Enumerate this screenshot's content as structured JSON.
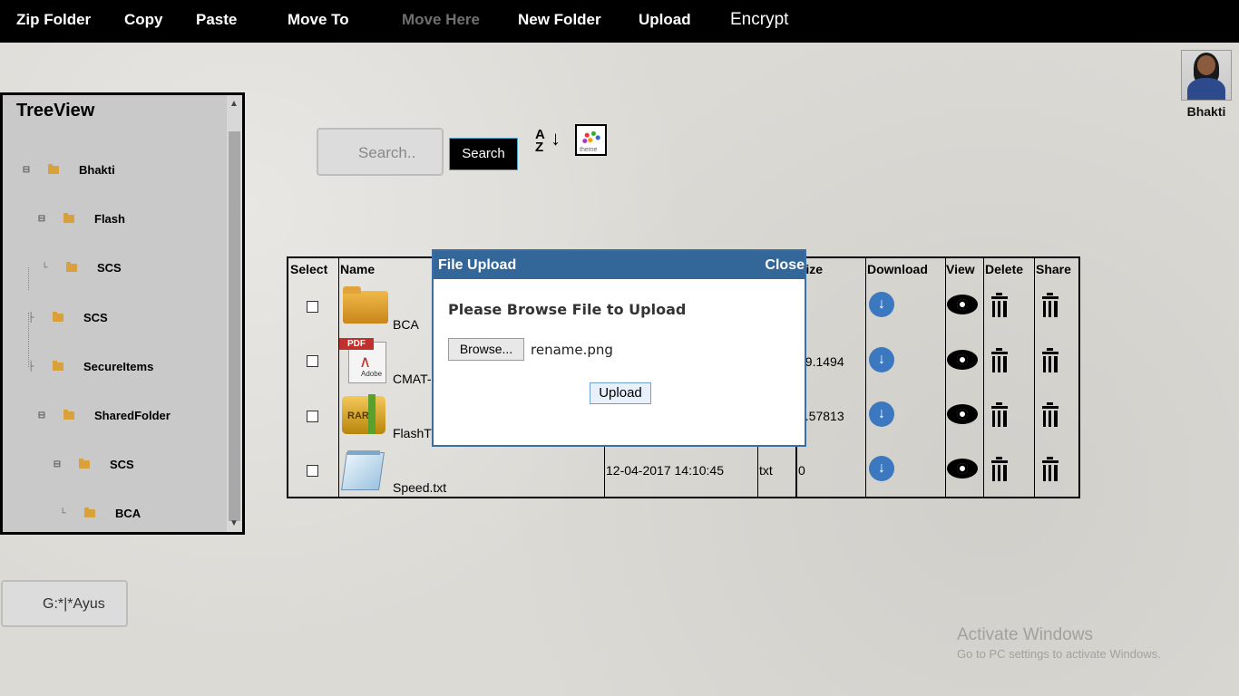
{
  "menu": {
    "zip_folder": "Zip Folder",
    "copy": "Copy",
    "paste": "Paste",
    "move_to": "Move To",
    "move_here": "Move Here",
    "new_folder": "New Folder",
    "upload": "Upload",
    "encrypt": "Encrypt"
  },
  "user": {
    "name": "Bhakti"
  },
  "tree": {
    "title": "TreeView",
    "nodes": [
      "Bhakti",
      "Flash",
      "SCS",
      "SCS",
      "SecureItems",
      "SharedFolder",
      "SCS",
      "BCA"
    ]
  },
  "search": {
    "placeholder": "Search..",
    "button": "Search"
  },
  "table": {
    "headers": {
      "select": "Select",
      "name": "Name",
      "size": "Size",
      "download": "Download",
      "view": "View",
      "delete": "Delete",
      "share": "Share"
    },
    "rows": [
      {
        "name": "BCA",
        "date": "",
        "type": "",
        "size": ""
      },
      {
        "name": "CMAT-",
        "date": "",
        "type": "",
        "size": "39.1494"
      },
      {
        "name": "FlashT",
        "date": "",
        "type": "",
        "size": "9.57813"
      },
      {
        "name": "Speed.txt",
        "date": "12-04-2017 14:10:45",
        "type": "txt",
        "size": "0"
      }
    ]
  },
  "modal": {
    "title": "File Upload",
    "close": "Close",
    "message": "Please Browse File to Upload",
    "browse": "Browse...",
    "file_name": "rename.png",
    "upload": "Upload"
  },
  "path": {
    "value": "G:*|*Ayus"
  },
  "watermark": {
    "line1": "Activate Windows",
    "line2": "Go to PC settings to activate Windows."
  }
}
